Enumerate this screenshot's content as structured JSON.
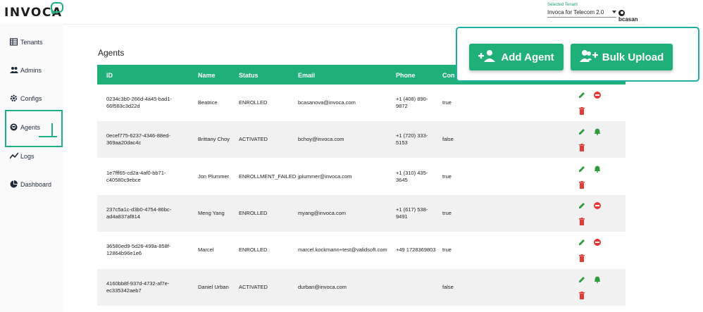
{
  "app": {
    "brand": "INVOCA",
    "accent": "#1fb07a"
  },
  "header": {
    "tenant_label": "Selected Tenant",
    "tenant_value": "Invoca for Telecom 2.0",
    "user": "bcasan"
  },
  "sidebar": {
    "items": [
      {
        "label": "Tenants",
        "icon": "table-icon"
      },
      {
        "label": "Admins",
        "icon": "people-icon"
      },
      {
        "label": "Configs",
        "icon": "gear-icon"
      },
      {
        "label": "Agents",
        "icon": "headset-icon",
        "active": true
      },
      {
        "label": "Logs",
        "icon": "trend-icon"
      },
      {
        "label": "Dashboard",
        "icon": "pie-icon"
      }
    ]
  },
  "main": {
    "title": "Agents",
    "add_agent_label": "Add Agent",
    "bulk_upload_label": "Bulk Upload",
    "columns": [
      "ID",
      "Name",
      "Status",
      "Email",
      "Phone",
      "Con"
    ],
    "rows": [
      {
        "id_1": "0234c3b0-266d-4a45-bad1-",
        "id_2": "66f583c3d22d",
        "name": "Beatrice",
        "status": "ENROLLED",
        "email": "bcasanova@invoca.com",
        "phone_1": "+1 (408) 890-",
        "phone_2": "9872",
        "con": "true",
        "icon": "block-icon"
      },
      {
        "id_1": "0ecef775-6237-4346-88ed-",
        "id_2": "369aa20dac4c",
        "name": "Brittany Choy",
        "status": "ACTIVATED",
        "email": "bchoy@invoca.com",
        "phone_1": "+1 (720) 333-",
        "phone_2": "5153",
        "con": "false",
        "icon": "bell-icon"
      },
      {
        "id_1": "1e7fff65-cd2a-4af0-bb71-",
        "id_2": "c40580c9ebce",
        "name": "Jon Plummer",
        "status": "ENROLLMENT_FAILED",
        "email": "jplummer@invoca.com",
        "phone_1": "+1 (310) 435-",
        "phone_2": "3645",
        "con": "true",
        "icon": "bell-icon"
      },
      {
        "id_1": "237c5a1c-d3b0-4754-86bc-",
        "id_2": "ad4a837af814",
        "name": "Meng Yang",
        "status": "ENROLLED",
        "email": "myang@invoca.com",
        "phone_1": "+1 (617) 538-",
        "phone_2": "9491",
        "con": "true",
        "icon": "block-icon"
      },
      {
        "id_1": "36580ed9-5d26-499a-858f-",
        "id_2": "12864b96e1e6",
        "name": "Marcel",
        "status": "ENROLLED",
        "email": "marcel.kockmann+test@validsoft.com",
        "phone_1": "+49 1728369803",
        "phone_2": "",
        "con": "true",
        "icon": "block-icon"
      },
      {
        "id_1": "4160bb8f-937d-4732-af7e-",
        "id_2": "ec335342aeb7",
        "name": "Daniel Urban",
        "status": "ACTIVATED",
        "email": "durban@invoca.com",
        "phone_1": "",
        "phone_2": "",
        "con": "false",
        "icon": "bell-icon"
      }
    ]
  }
}
